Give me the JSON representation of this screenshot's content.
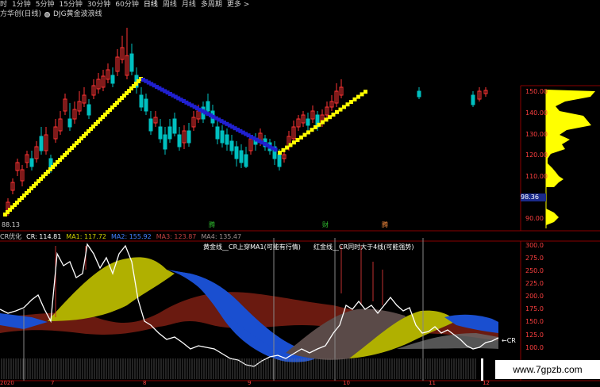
{
  "toolbar": {
    "items": [
      "时",
      "1分钟",
      "5分钟",
      "15分钟",
      "30分钟",
      "60分钟",
      "日线",
      "周线",
      "月线",
      "多周期",
      "更多 >"
    ],
    "active_index": 6
  },
  "subtitle": {
    "name": "方华创(日线)",
    "indicator": "DJG黄金波浪线"
  },
  "price_axis": {
    "ticks": [
      "150.00",
      "140.00",
      "130.00",
      "120.00",
      "110.00",
      "90.00"
    ],
    "current": "98.36",
    "low_label": "88.13"
  },
  "markers": {
    "m1": "腾",
    "m2": "财",
    "m3": "腾"
  },
  "indicator_bar": {
    "name": "CR优化",
    "cr": "CR: 114.81",
    "ma1": "MA1: 117.72",
    "ma2": "MA2: 155.92",
    "ma3": "MA3: 123.87",
    "ma4": "MA4: 135.47"
  },
  "indicator_axis": {
    "ticks": [
      "300.0",
      "275.0",
      "250.0",
      "225.0",
      "200.0",
      "175.0",
      "150.0",
      "125.0",
      "100.0"
    ]
  },
  "annotations": {
    "yellow_line": "黄金线__CR上穿MA1(可能有行情)",
    "red_line": "红金线__CR同时大于4线(可能强势)",
    "cr_label": "←CR"
  },
  "date_axis": {
    "labels": [
      "2020",
      "7",
      "8",
      "9",
      "10",
      "11",
      "12"
    ]
  },
  "watermark": "www.7gpzb.com",
  "colors": {
    "background": "#000000",
    "up": "#ff3333",
    "down": "#00c0c0",
    "yellow_band": "#c8c800",
    "blue_band": "#1a4fd0",
    "red_band": "#6a1a10",
    "gray_band": "#5a4a48",
    "cr_line": "#ffffff"
  }
}
